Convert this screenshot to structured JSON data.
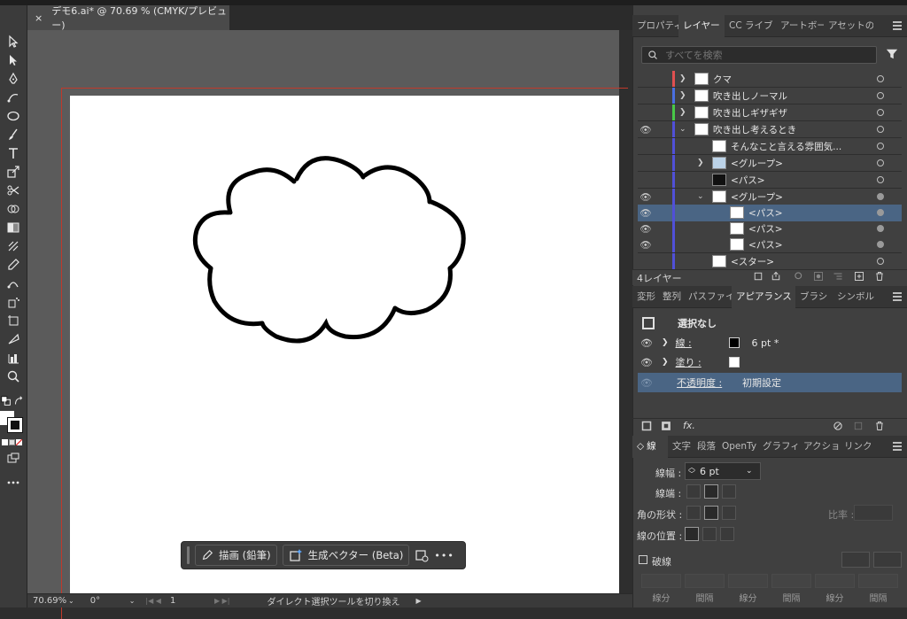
{
  "document_tab": {
    "close": "×",
    "title": "デモ6.ai* @ 70.69 % (CMYK/プレビュー)"
  },
  "context_bar": {
    "draw_label": "描画 (鉛筆)",
    "vector_label": "生成ベクター (Beta)",
    "more": "•••"
  },
  "status": {
    "zoom": "70.69%",
    "rotation": "0°",
    "artboard": "1",
    "message": "ダイレクト選択ツールを切り換え"
  },
  "layers_panel": {
    "tabs": [
      "プロパティ",
      "レイヤー",
      "CC ライブ",
      "アートボー",
      "アセットの"
    ],
    "search_placeholder": "すべてを検索",
    "rows": [
      {
        "name": "クマ",
        "color": "#e05050"
      },
      {
        "name": "吹き出しノーマル",
        "color": "#4a6fe0"
      },
      {
        "name": "吹き出しギザギザ",
        "color": "#48c848"
      },
      {
        "name": "吹き出し考えるとき",
        "color": "#5050d8"
      },
      {
        "name": "そんなこと言える雰囲気..."
      },
      {
        "name": "<グループ>"
      },
      {
        "name": "<パス>"
      },
      {
        "name": "<グループ>"
      },
      {
        "name": "<パス>"
      },
      {
        "name": "<パス>"
      },
      {
        "name": "<パス>"
      },
      {
        "name": "<スター>"
      }
    ],
    "layer_count": "4レイヤー"
  },
  "appearance_panel": {
    "tabs": [
      "変形",
      "整列",
      "パスファイ",
      "アピアランス",
      "ブラシ",
      "シンボル"
    ],
    "selection": "選択なし",
    "stroke_label": "線 :",
    "stroke_value": "6 pt *",
    "fill_label": "塗り :",
    "opacity_label": "不透明度 :",
    "opacity_value": "初期設定",
    "fx": "fx."
  },
  "stroke_panel": {
    "tabs": [
      "線",
      "文字",
      "段落",
      "OpenTy",
      "グラフィ",
      "アクショ",
      "リンク"
    ],
    "weight_label": "線幅 :",
    "weight_value": "6 pt",
    "cap_label": "線端 :",
    "corner_label": "角の形状 :",
    "ratio_label": "比率 :",
    "align_label": "線の位置 :",
    "dashed_label": "破線",
    "dash_labels": [
      "線分",
      "間隔",
      "線分",
      "間隔",
      "線分",
      "間隔"
    ]
  }
}
